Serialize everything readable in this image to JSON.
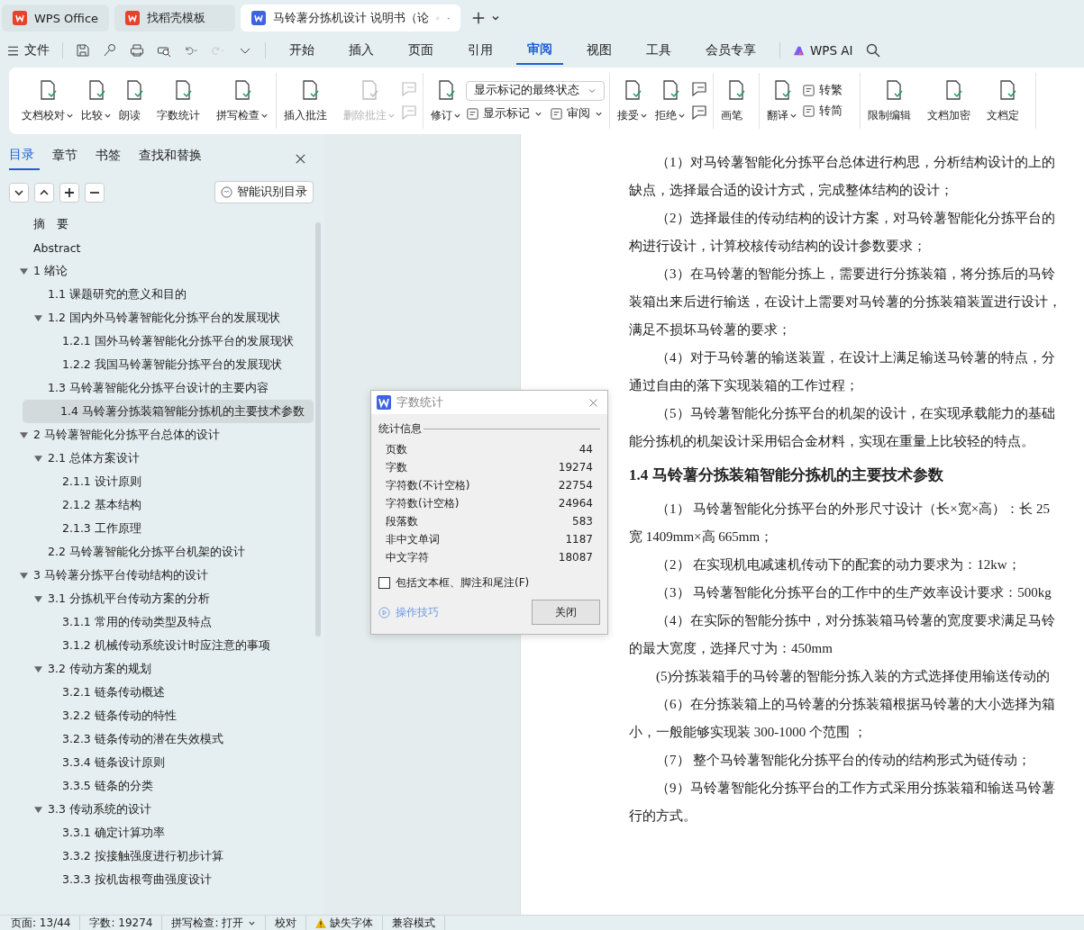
{
  "browser_tabs": [
    {
      "label": "WPS Office",
      "selected": false,
      "color": "#e8412c"
    },
    {
      "label": "找稻壳模板",
      "selected": false,
      "color": "#e8412c"
    },
    {
      "label": "马铃薯分拣机设计 说明书（论",
      "selected": true,
      "color": "#3d63e0"
    }
  ],
  "menu": {
    "file": "文件",
    "tabs": [
      {
        "label": "开始",
        "selected": false
      },
      {
        "label": "插入",
        "selected": false
      },
      {
        "label": "页面",
        "selected": false
      },
      {
        "label": "引用",
        "selected": false
      },
      {
        "label": "审阅",
        "selected": true
      },
      {
        "label": "视图",
        "selected": false
      },
      {
        "label": "工具",
        "selected": false
      },
      {
        "label": "会员专享",
        "selected": false
      }
    ],
    "ai": "WPS AI"
  },
  "ribbon": [
    {
      "items": [
        {
          "label": "文档校对",
          "dropdown": true,
          "disabled": false
        },
        {
          "label": "比较",
          "dropdown": true,
          "disabled": false
        },
        {
          "label": "朗读",
          "dropdown": false,
          "disabled": false
        },
        {
          "label": "字数统计",
          "dropdown": false,
          "disabled": false
        },
        {
          "label": "拼写检查",
          "dropdown": true,
          "disabled": false
        }
      ]
    },
    {
      "items": [
        {
          "label": "插入批注",
          "dropdown": false,
          "disabled": false
        },
        {
          "label": "删除批注",
          "dropdown": true,
          "disabled": true
        }
      ],
      "stack": [
        [
          {
            "kind": "icon",
            "disabled": true
          }
        ],
        [
          {
            "kind": "icon",
            "disabled": true
          }
        ]
      ]
    },
    {
      "items": [
        {
          "label": "修订",
          "dropdown": true,
          "disabled": false
        }
      ],
      "stack": [
        [
          {
            "kind": "select",
            "label": "显示标记的最终状态"
          }
        ],
        [
          {
            "kind": "small",
            "label": "显示标记",
            "dropdown": true,
            "disabled": false
          },
          {
            "kind": "small",
            "label": "审阅",
            "dropdown": true,
            "disabled": false
          }
        ]
      ]
    },
    {
      "items": [
        {
          "label": "接受",
          "dropdown": true,
          "disabled": false
        },
        {
          "label": "拒绝",
          "dropdown": true,
          "disabled": false
        }
      ],
      "stack": [
        [
          {
            "kind": "icon",
            "disabled": false
          }
        ],
        [
          {
            "kind": "icon",
            "disabled": false
          }
        ]
      ]
    },
    {
      "items": [
        {
          "label": "画笔",
          "dropdown": false,
          "disabled": false
        }
      ]
    },
    {
      "items": [
        {
          "label": "翻译",
          "dropdown": true,
          "disabled": false
        }
      ],
      "stack": [
        [
          {
            "kind": "small",
            "label": "转繁",
            "dropdown": false,
            "disabled": false
          }
        ],
        [
          {
            "kind": "small",
            "label": "转简",
            "dropdown": false,
            "disabled": false
          }
        ]
      ]
    },
    {
      "items": [
        {
          "label": "限制编辑",
          "dropdown": false,
          "disabled": false
        },
        {
          "label": "文档加密",
          "dropdown": false,
          "disabled": false
        },
        {
          "label": "文档定",
          "dropdown": false,
          "disabled": false
        }
      ]
    }
  ],
  "nav": {
    "tabs": [
      {
        "label": "目录",
        "selected": true
      },
      {
        "label": "章节",
        "selected": false
      },
      {
        "label": "书签",
        "selected": false
      },
      {
        "label": "查找和替换",
        "selected": false
      }
    ],
    "smart_button": "智能识别目录",
    "items": [
      {
        "label": "摘　要",
        "selected": false
      },
      {
        "label": "Abstract",
        "selected": false
      },
      {
        "label": "1  绪论",
        "selected": false,
        "expanded": true,
        "children": [
          {
            "label": "1.1  课题研究的意义和目的",
            "selected": false
          },
          {
            "label": "1.2  国内外马铃薯智能化分拣平台的发展现状",
            "selected": false,
            "expanded": true,
            "children": [
              {
                "label": "1.2.1 国外马铃薯智能化分拣平台的发展现状",
                "selected": false
              },
              {
                "label": "1.2.2  我国马铃薯智能分拣平台的发展现状",
                "selected": false
              }
            ]
          },
          {
            "label": "1.3  马铃薯智能化分拣平台设计的主要内容",
            "selected": false
          },
          {
            "label": "1.4  马铃薯分拣装箱智能分拣机的主要技术参数",
            "selected": true
          }
        ]
      },
      {
        "label": "2  马铃薯智能化分拣平台总体的设计",
        "selected": false,
        "expanded": true,
        "children": [
          {
            "label": "2.1  总体方案设计",
            "selected": false,
            "expanded": true,
            "children": [
              {
                "label": "2.1.1  设计原则",
                "selected": false
              },
              {
                "label": "2.1.2  基本结构",
                "selected": false
              },
              {
                "label": "2.1.3  工作原理",
                "selected": false
              }
            ]
          },
          {
            "label": "2.2 马铃薯智能化分拣平台机架的设计",
            "selected": false
          }
        ]
      },
      {
        "label": "3  马铃薯分拣平台传动结构的设计",
        "selected": false,
        "expanded": true,
        "children": [
          {
            "label": "3.1 分拣机平台传动方案的分析",
            "selected": false,
            "expanded": true,
            "children": [
              {
                "label": "3.1.1 常用的传动类型及特点",
                "selected": false
              },
              {
                "label": "3.1.2 机械传动系统设计时应注意的事项",
                "selected": false
              }
            ]
          },
          {
            "label": "3.2  传动方案的规划",
            "selected": false,
            "expanded": true,
            "children": [
              {
                "label": "3.2.1  链条传动概述",
                "selected": false
              },
              {
                "label": "3.2.2  链条传动的特性",
                "selected": false
              },
              {
                "label": "3.2.3  链条传动的潜在失效模式",
                "selected": false
              },
              {
                "label": "3.3.4  链条设计原则",
                "selected": false
              },
              {
                "label": "3.3.5  链条的分类",
                "selected": false
              }
            ]
          },
          {
            "label": "3.3 传动系统的设计",
            "selected": false,
            "expanded": true,
            "children": [
              {
                "label": "3.3.1 确定计算功率",
                "selected": false
              },
              {
                "label": "3.3.2 按接触强度进行初步计算",
                "selected": false
              },
              {
                "label": "3.3.3 按机齿根弯曲强度设计",
                "selected": false
              }
            ]
          }
        ]
      }
    ]
  },
  "document": [
    {
      "kind": "first",
      "text": "（1）对马铃薯智能化分拣平台总体进行构思，分析结构设计的上的"
    },
    {
      "kind": "line",
      "text": "缺点，选择最合适的设计方式，完成整体结构的设计；"
    },
    {
      "kind": "first",
      "text": "（2）选择最佳的传动结构的设计方案，对马铃薯智能化分拣平台的"
    },
    {
      "kind": "line",
      "text": "构进行设计，计算校核传动结构的设计参数要求；"
    },
    {
      "kind": "first",
      "text": "（3）在马铃薯的智能分拣上，需要进行分拣装箱，将分拣后的马铃"
    },
    {
      "kind": "line",
      "text": "装箱出来后进行输送，在设计上需要对马铃薯的分拣装箱装置进行设计，"
    },
    {
      "kind": "line",
      "text": "满足不损坏马铃薯的要求；"
    },
    {
      "kind": "first",
      "text": "（4）对于马铃薯的输送装置，在设计上满足输送马铃薯的特点，分"
    },
    {
      "kind": "line",
      "text": "通过自由的落下实现装箱的工作过程；"
    },
    {
      "kind": "first",
      "text": "（5）马铃薯智能化分拣平台的机架的设计，在实现承载能力的基础"
    },
    {
      "kind": "line",
      "text": "能分拣机的机架设计采用铝合金材料，实现在重量上比较轻的特点。"
    },
    {
      "kind": "heading",
      "text": "1.4  马铃薯分拣装箱智能分拣机的主要技术参数"
    },
    {
      "kind": "first",
      "text": "（1）  马铃薯智能化分拣平台的外形尺寸设计（长×宽×高）：长 25"
    },
    {
      "kind": "line",
      "text": "宽 1409mm×高 665mm；"
    },
    {
      "kind": "first",
      "text": "（2）  在实现机电减速机传动下的配套的动力要求为：12kw；"
    },
    {
      "kind": "first",
      "text": "（3）  马铃薯智能化分拣平台的工作中的生产效率设计要求：500kg"
    },
    {
      "kind": "first",
      "text": "（4）在实际的智能分拣中，对分拣装箱马铃薯的宽度要求满足马铃"
    },
    {
      "kind": "line",
      "text": "的最大宽度，选择尺寸为：450mm"
    },
    {
      "kind": "first",
      "text": "(5)分拣装箱手的马铃薯的智能分拣入装的方式选择使用输送传动的"
    },
    {
      "kind": "first",
      "text": "（6）在分拣装箱上的马铃薯的分拣装箱根据马铃薯的大小选择为箱"
    },
    {
      "kind": "line",
      "text": "小，一般能够实现装 300-1000 个范围 ；"
    },
    {
      "kind": "first",
      "text": "（7）  整个马铃薯智能化分拣平台的传动的结构形式为链传动；"
    },
    {
      "kind": "first",
      "text": "（9）马铃薯智能化分拣平台的工作方式采用分拣装箱和输送马铃薯"
    },
    {
      "kind": "line",
      "text": "行的方式。"
    }
  ],
  "dialog": {
    "title": "字数统计",
    "group": "统计信息",
    "stats": [
      {
        "label": "页数",
        "value": "44"
      },
      {
        "label": "字数",
        "value": "19274"
      },
      {
        "label": "字符数(不计空格)",
        "value": "22754"
      },
      {
        "label": "字符数(计空格)",
        "value": "24964"
      },
      {
        "label": "段落数",
        "value": "583"
      },
      {
        "label": "非中文单词",
        "value": "1187"
      },
      {
        "label": "中文字符",
        "value": "18087"
      }
    ],
    "checkbox": {
      "label": "包括文本框、脚注和尾注(F)",
      "checked": false
    },
    "tips": "操作技巧",
    "close": "关闭"
  },
  "status_bar": [
    {
      "kind": "text",
      "label": "页面: 13/44"
    },
    {
      "kind": "text",
      "label": "字数: 19274"
    },
    {
      "kind": "dropdown",
      "label": "拼写检查: 打开"
    },
    {
      "kind": "text",
      "label": "校对"
    },
    {
      "kind": "warning",
      "label": "缺失字体"
    },
    {
      "kind": "text",
      "label": "兼容模式"
    }
  ]
}
